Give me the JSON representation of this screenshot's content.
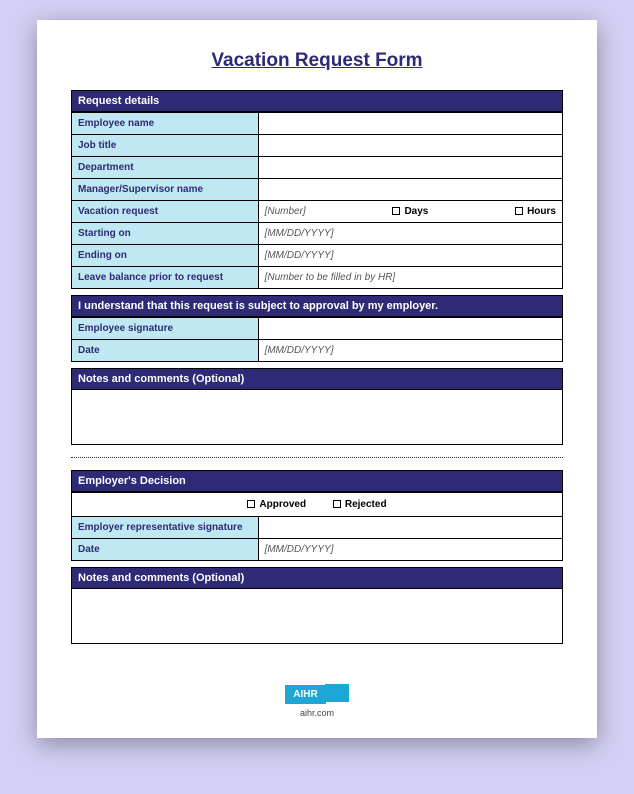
{
  "title": "Vacation Request Form",
  "request_details": {
    "header": "Request details",
    "employee_name_label": "Employee name",
    "job_title_label": "Job title",
    "department_label": "Department",
    "manager_label": "Manager/Supervisor name",
    "vacation_request_label": "Vacation request",
    "vacation_request_placeholder": "[Number]",
    "days_label": "Days",
    "hours_label": "Hours",
    "starting_label": "Starting on",
    "starting_placeholder": "[MM/DD/YYYY]",
    "ending_label": "Ending on",
    "ending_placeholder": "[MM/DD/YYYY]",
    "balance_label": "Leave balance prior to request",
    "balance_placeholder": "[Number to be filled in by HR]"
  },
  "acknowledgement": {
    "header": "I understand that this request is subject to approval by my employer.",
    "signature_label": "Employee signature",
    "date_label": "Date",
    "date_placeholder": "[MM/DD/YYYY]"
  },
  "notes1": {
    "header": "Notes and comments (Optional)"
  },
  "decision": {
    "header": "Employer's Decision",
    "approved_label": "Approved",
    "rejected_label": "Rejected",
    "rep_signature_label": "Employer representative signature",
    "date_label": "Date",
    "date_placeholder": "[MM/DD/YYYY]"
  },
  "notes2": {
    "header": "Notes and comments (Optional)"
  },
  "footer": {
    "logo_text": "AIHR",
    "site": "aihr.com"
  }
}
